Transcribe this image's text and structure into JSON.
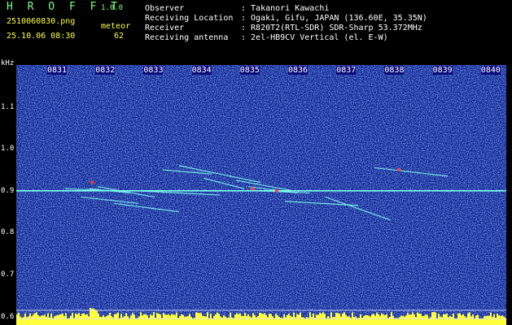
{
  "app": {
    "name": "H R O F F T",
    "version": "1.0.0"
  },
  "file": {
    "name": "2510060830.png",
    "timestamp": "25.10.06 08:30",
    "meteor_label": "meteor",
    "meteor_count": "62"
  },
  "info": [
    {
      "key": "Observer",
      "value": ": Takanori Kawachi"
    },
    {
      "key": "Receiving Location",
      "value": ": Ogaki, Gifu, JAPAN (136.60E, 35.35N)"
    },
    {
      "key": "Receiver",
      "value": ": R820T2(RTL-SDR) SDR-Sharp 53.372MHz"
    },
    {
      "key": "Receiving antenna",
      "value": ": 2el-HB9CV Vertical (el. E-W)"
    }
  ],
  "chart_data": {
    "type": "heatmap",
    "yunit": "kHz",
    "yticks": [
      "1.1",
      "1.0",
      "0.9",
      "0.8",
      "0.7",
      "0.6"
    ],
    "xticks": [
      "0831",
      "0832",
      "0833",
      "0834",
      "0835",
      "0836",
      "0837",
      "0838",
      "0839",
      "0840"
    ],
    "ylim": [
      0.58,
      1.2
    ],
    "carrier_khz": 0.9,
    "colors": {
      "background": "#0b1b8c",
      "noise": "#3a7bff",
      "trace": "#7dfff0",
      "hot": "#ff4040",
      "lowband": "#ffff3c"
    }
  }
}
